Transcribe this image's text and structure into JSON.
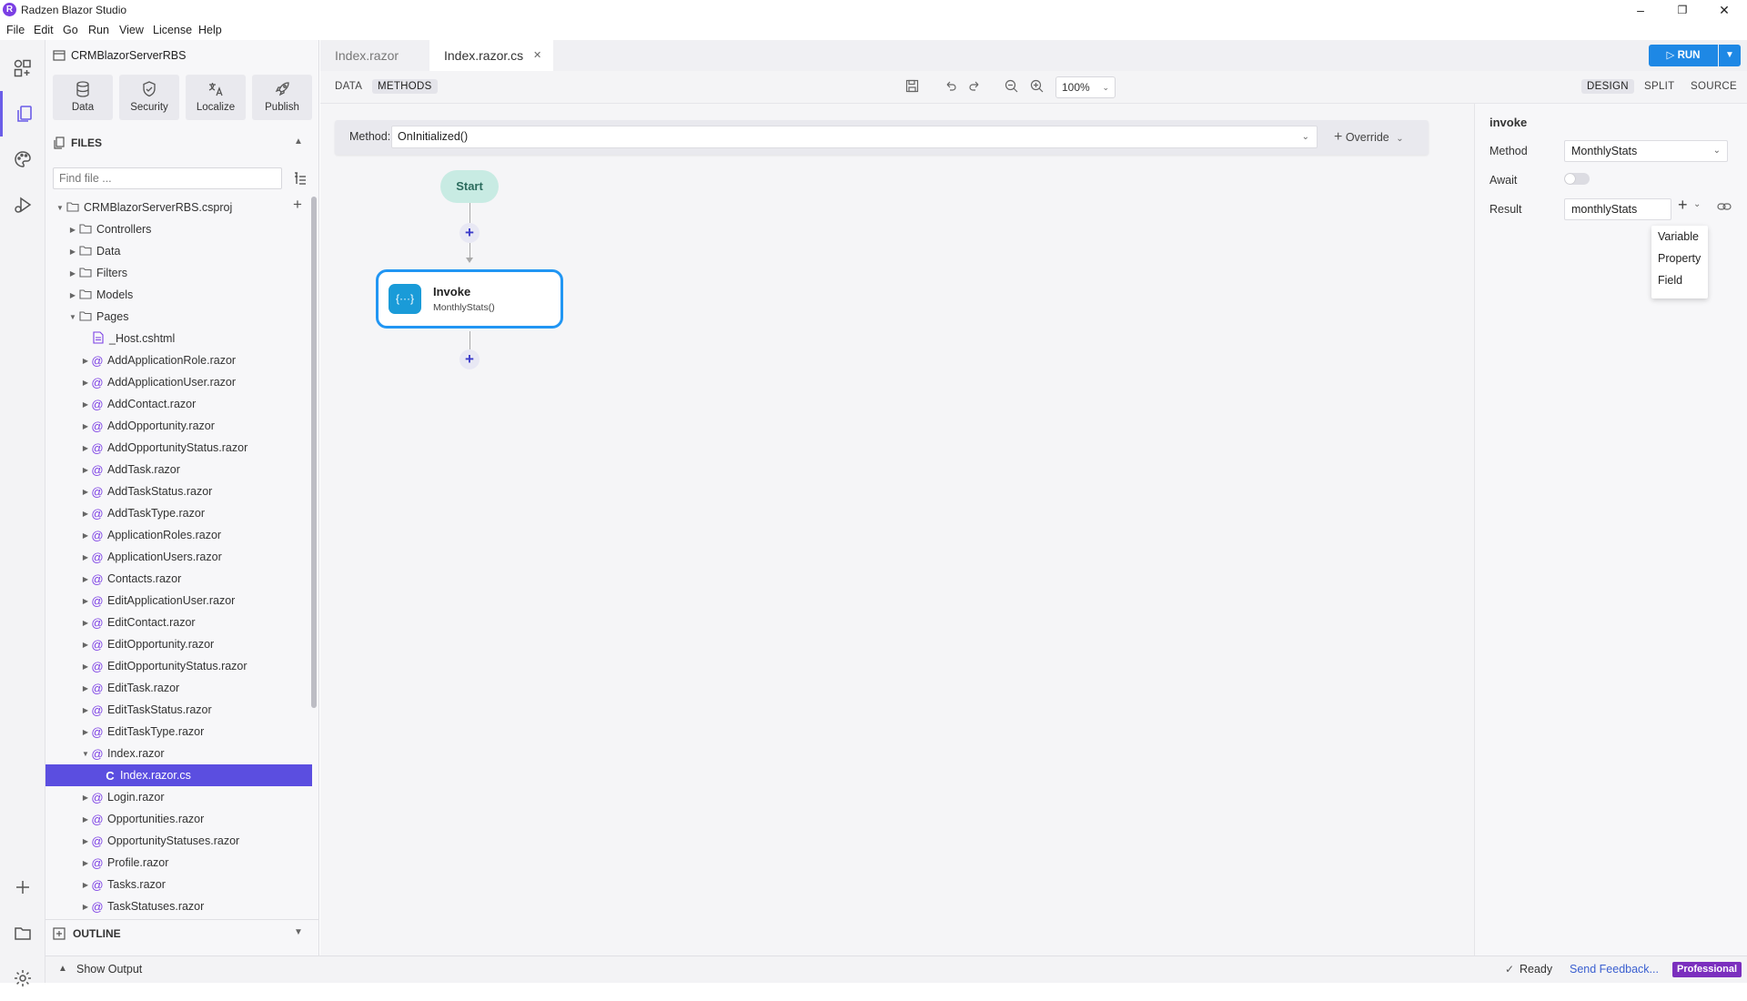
{
  "window": {
    "title": "Radzen Blazor Studio",
    "minimize": "–",
    "restore": "❐",
    "close": "✕"
  },
  "menu": [
    "File",
    "Edit",
    "Go",
    "Run",
    "View",
    "License",
    "Help"
  ],
  "sidebar": {
    "project_name": "CRMBlazorServerRBS",
    "tools": [
      {
        "label": "Data",
        "icon": "database-icon"
      },
      {
        "label": "Security",
        "icon": "shield-icon"
      },
      {
        "label": "Localize",
        "icon": "translate-icon"
      },
      {
        "label": "Publish",
        "icon": "rocket-icon"
      }
    ],
    "files_title": "FILES",
    "find_placeholder": "Find file ...",
    "tree": [
      {
        "label": "CRMBlazorServerRBS.csproj",
        "kind": "folder",
        "level": 0,
        "expanded": true
      },
      {
        "label": "Controllers",
        "kind": "folder",
        "level": 1
      },
      {
        "label": "Data",
        "kind": "folder",
        "level": 1
      },
      {
        "label": "Filters",
        "kind": "folder",
        "level": 1
      },
      {
        "label": "Models",
        "kind": "folder",
        "level": 1
      },
      {
        "label": "Pages",
        "kind": "folder",
        "level": 1,
        "expanded": true
      },
      {
        "label": "_Host.cshtml",
        "kind": "file",
        "level": 2
      },
      {
        "label": "AddApplicationRole.razor",
        "kind": "razor",
        "level": 2
      },
      {
        "label": "AddApplicationUser.razor",
        "kind": "razor",
        "level": 2
      },
      {
        "label": "AddContact.razor",
        "kind": "razor",
        "level": 2
      },
      {
        "label": "AddOpportunity.razor",
        "kind": "razor",
        "level": 2
      },
      {
        "label": "AddOpportunityStatus.razor",
        "kind": "razor",
        "level": 2
      },
      {
        "label": "AddTask.razor",
        "kind": "razor",
        "level": 2
      },
      {
        "label": "AddTaskStatus.razor",
        "kind": "razor",
        "level": 2
      },
      {
        "label": "AddTaskType.razor",
        "kind": "razor",
        "level": 2
      },
      {
        "label": "ApplicationRoles.razor",
        "kind": "razor",
        "level": 2
      },
      {
        "label": "ApplicationUsers.razor",
        "kind": "razor",
        "level": 2
      },
      {
        "label": "Contacts.razor",
        "kind": "razor",
        "level": 2
      },
      {
        "label": "EditApplicationUser.razor",
        "kind": "razor",
        "level": 2
      },
      {
        "label": "EditContact.razor",
        "kind": "razor",
        "level": 2
      },
      {
        "label": "EditOpportunity.razor",
        "kind": "razor",
        "level": 2
      },
      {
        "label": "EditOpportunityStatus.razor",
        "kind": "razor",
        "level": 2
      },
      {
        "label": "EditTask.razor",
        "kind": "razor",
        "level": 2
      },
      {
        "label": "EditTaskStatus.razor",
        "kind": "razor",
        "level": 2
      },
      {
        "label": "EditTaskType.razor",
        "kind": "razor",
        "level": 2
      },
      {
        "label": "Index.razor",
        "kind": "razor",
        "level": 2,
        "expanded": true
      },
      {
        "label": "Index.razor.cs",
        "kind": "cs",
        "level": 3,
        "selected": true
      },
      {
        "label": "Login.razor",
        "kind": "razor",
        "level": 2
      },
      {
        "label": "Opportunities.razor",
        "kind": "razor",
        "level": 2
      },
      {
        "label": "OpportunityStatuses.razor",
        "kind": "razor",
        "level": 2
      },
      {
        "label": "Profile.razor",
        "kind": "razor",
        "level": 2
      },
      {
        "label": "Tasks.razor",
        "kind": "razor",
        "level": 2
      },
      {
        "label": "TaskStatuses.razor",
        "kind": "razor",
        "level": 2
      }
    ],
    "outline_title": "OUTLINE"
  },
  "status": {
    "show_output": "Show Output",
    "ready": "Ready",
    "feedback": "Send Feedback...",
    "license_badge": "Professional"
  },
  "tabs": [
    {
      "label": "Index.razor",
      "active": false
    },
    {
      "label": "Index.razor.cs",
      "active": true,
      "close": "✕"
    }
  ],
  "run_label": "RUN",
  "designer": {
    "tabs": [
      {
        "label": "DATA",
        "active": false
      },
      {
        "label": "METHODS",
        "active": true
      }
    ],
    "zoom": "100%",
    "view_modes": [
      {
        "label": "DESIGN",
        "active": true
      },
      {
        "label": "SPLIT",
        "active": false
      },
      {
        "label": "SOURCE",
        "active": false
      }
    ]
  },
  "canvas": {
    "method_label": "Method:",
    "method_value": "OnInitialized()",
    "override_label": "Override",
    "start_label": "Start",
    "invoke_title": "Invoke",
    "invoke_subtitle": "MonthlyStats()"
  },
  "properties": {
    "title": "invoke",
    "method_label": "Method",
    "method_value": "MonthlyStats",
    "await_label": "Await",
    "await_on": false,
    "result_label": "Result",
    "result_value": "monthlyStats",
    "result_options": [
      "Variable",
      "Property",
      "Field"
    ]
  },
  "colors": {
    "accent": "#5b4ee0",
    "run": "#1e88e5",
    "invoke_border": "#2196f3",
    "start_fill": "#c8ebe3",
    "badge": "#7b3fe4"
  }
}
